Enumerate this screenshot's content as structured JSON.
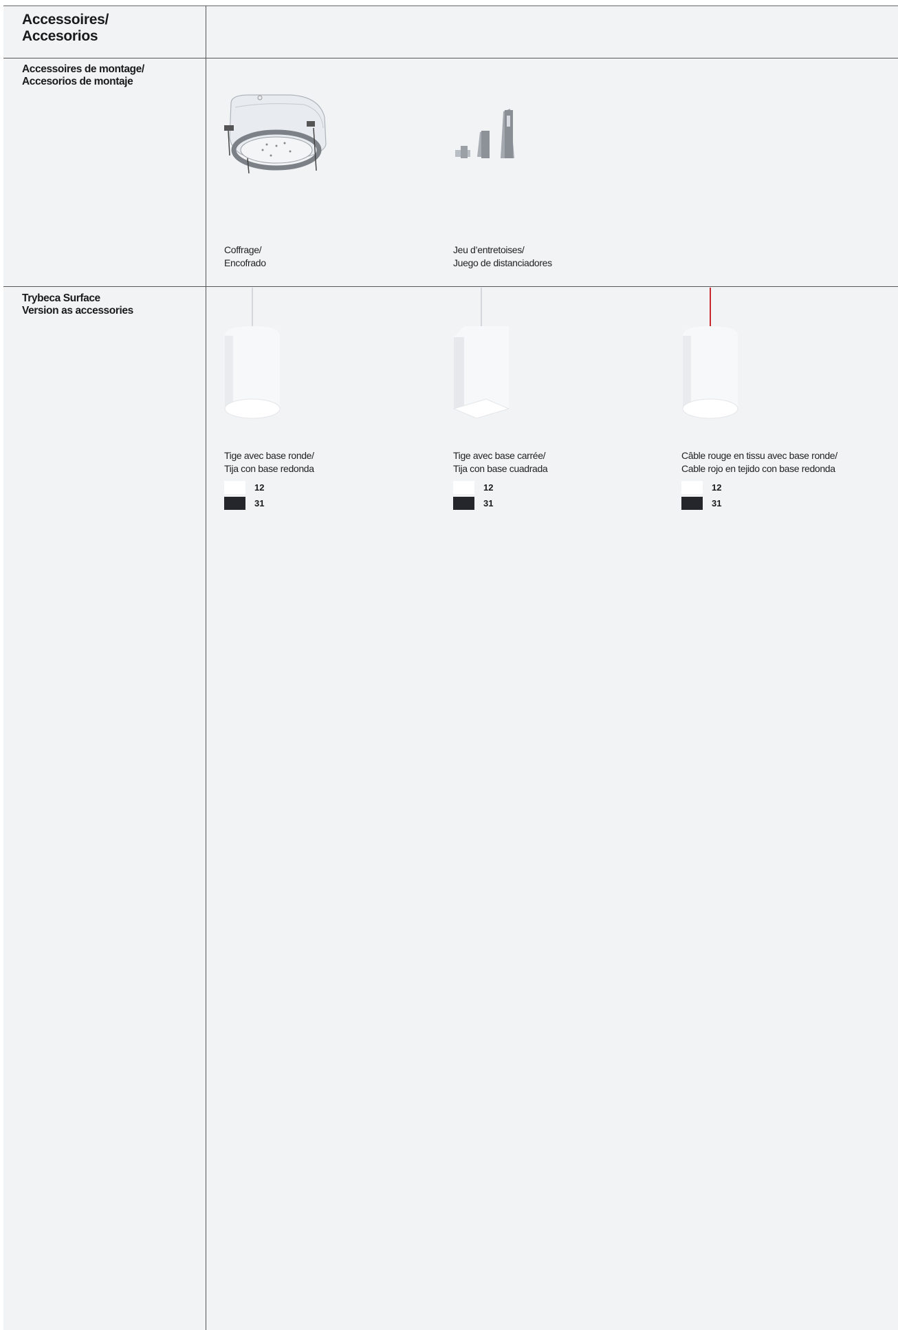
{
  "section_title": {
    "line1": "Accessoires/",
    "line2": "Accesorios"
  },
  "rows": [
    {
      "title": {
        "line1": "Accessoires de montage/",
        "line2": "Accesorios de montaje"
      },
      "items": [
        {
          "caption": {
            "line1": "Coffrage/",
            "line2": "Encofrado"
          }
        },
        {
          "caption": {
            "line1": "Jeu d’entretoises/",
            "line2": "Juego de distanciadores"
          }
        }
      ]
    },
    {
      "title": {
        "line1": "Trybeca Surface",
        "line2": "Version as accessories"
      },
      "items": [
        {
          "caption": {
            "line1": "Tige avec base ronde/",
            "line2": "Tija con base redonda"
          },
          "swatches": [
            {
              "code": "12",
              "color": "#ffffff"
            },
            {
              "code": "31",
              "color": "#25262b"
            }
          ]
        },
        {
          "caption": {
            "line1": "Tige avec base carrée/",
            "line2": "Tija con base cuadrada"
          },
          "swatches": [
            {
              "code": "12",
              "color": "#ffffff"
            },
            {
              "code": "31",
              "color": "#25262b"
            }
          ]
        },
        {
          "caption": {
            "line1": "Câble rouge en tissu avec base ronde/",
            "line2": "Cable rojo en tejido con base redonda"
          },
          "swatches": [
            {
              "code": "12",
              "color": "#ffffff"
            },
            {
              "code": "31",
              "color": "#25262b"
            }
          ]
        }
      ]
    }
  ]
}
